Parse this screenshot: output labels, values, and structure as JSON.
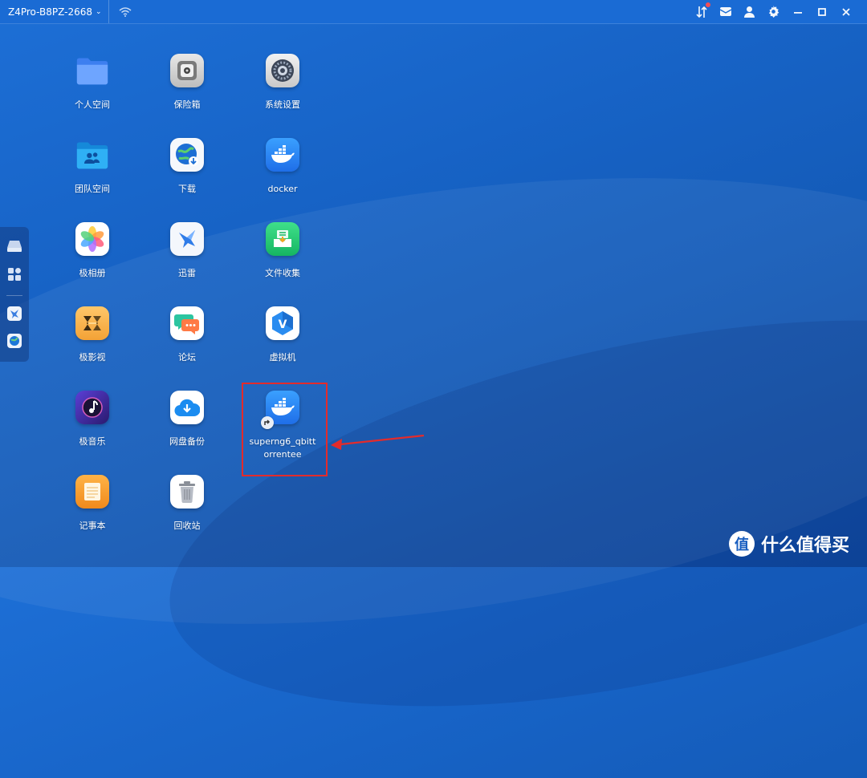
{
  "titlebar": {
    "device_name": "Z4Pro-B8PZ-2668",
    "icons": [
      "transfer-icon",
      "mail-icon",
      "user-icon",
      "gear-icon",
      "minimize-icon",
      "maximize-icon",
      "close-icon"
    ]
  },
  "dock": {
    "items": [
      "drive-icon",
      "apps-grid-icon",
      "thunder-icon",
      "download-globe-icon"
    ]
  },
  "apps": [
    {
      "label": "个人空间",
      "icon": "folder-icon"
    },
    {
      "label": "保险箱",
      "icon": "safe-icon"
    },
    {
      "label": "系统设置",
      "icon": "settings-icon"
    },
    {
      "label": "团队空间",
      "icon": "team-folder-icon"
    },
    {
      "label": "下载",
      "icon": "download-icon"
    },
    {
      "label": "docker",
      "icon": "docker-icon"
    },
    {
      "label": "极相册",
      "icon": "photos-icon"
    },
    {
      "label": "迅雷",
      "icon": "thunder-icon"
    },
    {
      "label": "文件收集",
      "icon": "file-collect-icon"
    },
    {
      "label": "极影视",
      "icon": "video-icon"
    },
    {
      "label": "论坛",
      "icon": "forum-icon"
    },
    {
      "label": "虚拟机",
      "icon": "vm-icon"
    },
    {
      "label": "极音乐",
      "icon": "music-icon"
    },
    {
      "label": "网盘备份",
      "icon": "cloud-backup-icon"
    },
    {
      "label": "superng6_qbittorrentee",
      "icon": "docker-app-icon"
    },
    {
      "label": "记事本",
      "icon": "notepad-icon"
    },
    {
      "label": "回收站",
      "icon": "trash-icon"
    }
  ],
  "watermark": {
    "text": "什么值得买",
    "logo": "值"
  },
  "colors": {
    "desktop": "#1763c6",
    "highlight": "#e42b2b"
  }
}
